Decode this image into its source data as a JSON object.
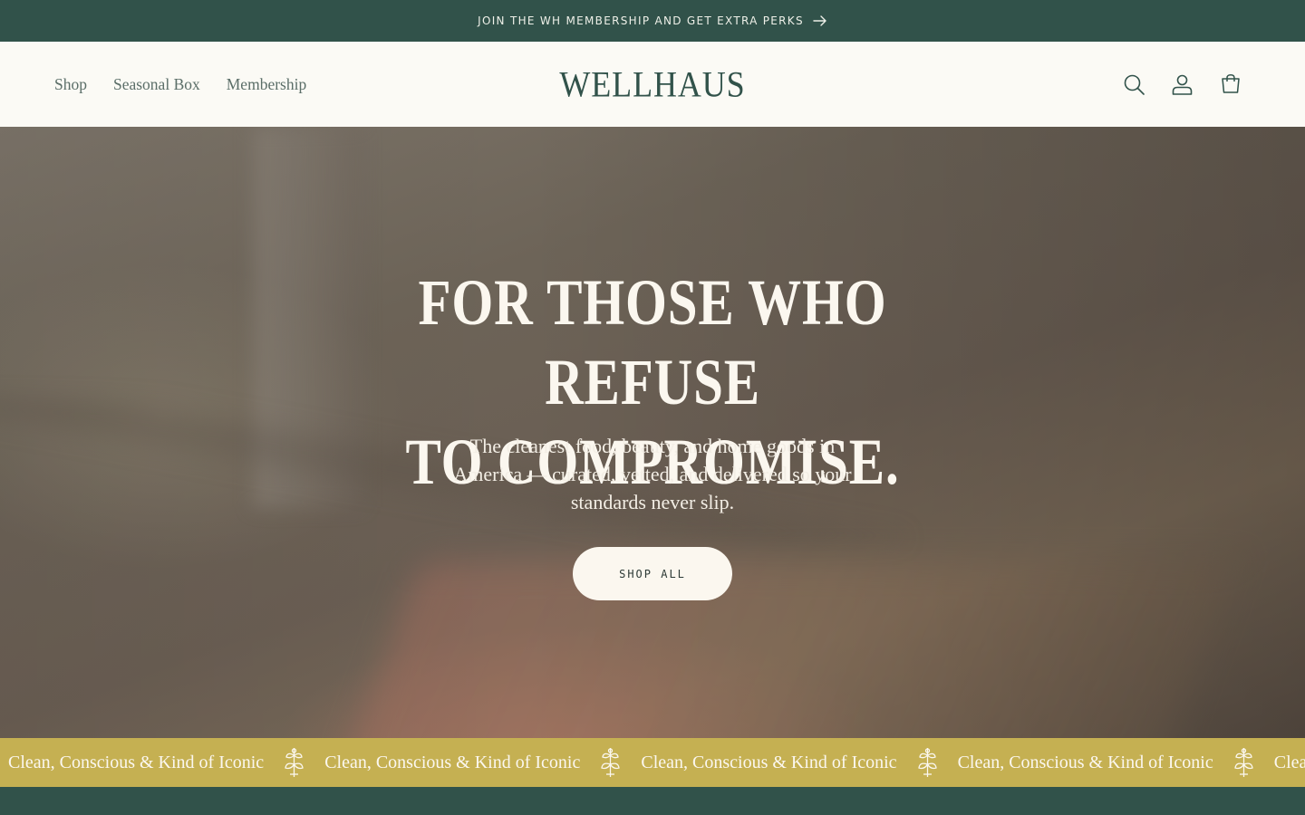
{
  "announcement": {
    "text": "JOIN THE WH MEMBERSHIP AND GET EXTRA PERKS",
    "icon": "arrow-right-icon"
  },
  "header": {
    "nav": [
      {
        "label": "Shop"
      },
      {
        "label": "Seasonal Box"
      },
      {
        "label": "Membership"
      }
    ],
    "logo": "WELLHAUS",
    "icons": [
      "search-icon",
      "account-icon",
      "cart-icon"
    ]
  },
  "hero": {
    "headline_line1": "FOR THOSE WHO REFUSE",
    "headline_line2": "TO COMPROMISE.",
    "subtext": "The cleanest food, beauty, and home goods in America — curated, vetted, and delivered so your standards never slip.",
    "cta_label": "SHOP ALL"
  },
  "ticker": {
    "items": [
      "Clean, Conscious & Kind of Iconic",
      "Clean, Conscious & Kind of Iconic",
      "Clean, Conscious & Kind of Iconic",
      "Clean, Conscious & Kind of Iconic",
      "Clean, Conscious & Kind of Iconic"
    ],
    "separator_icon": "floral-emblem-icon"
  },
  "colors": {
    "brand_green": "#31524a",
    "cream": "#fbfaf5",
    "mustard": "#c5b052",
    "nav_text": "#5b6e68"
  }
}
